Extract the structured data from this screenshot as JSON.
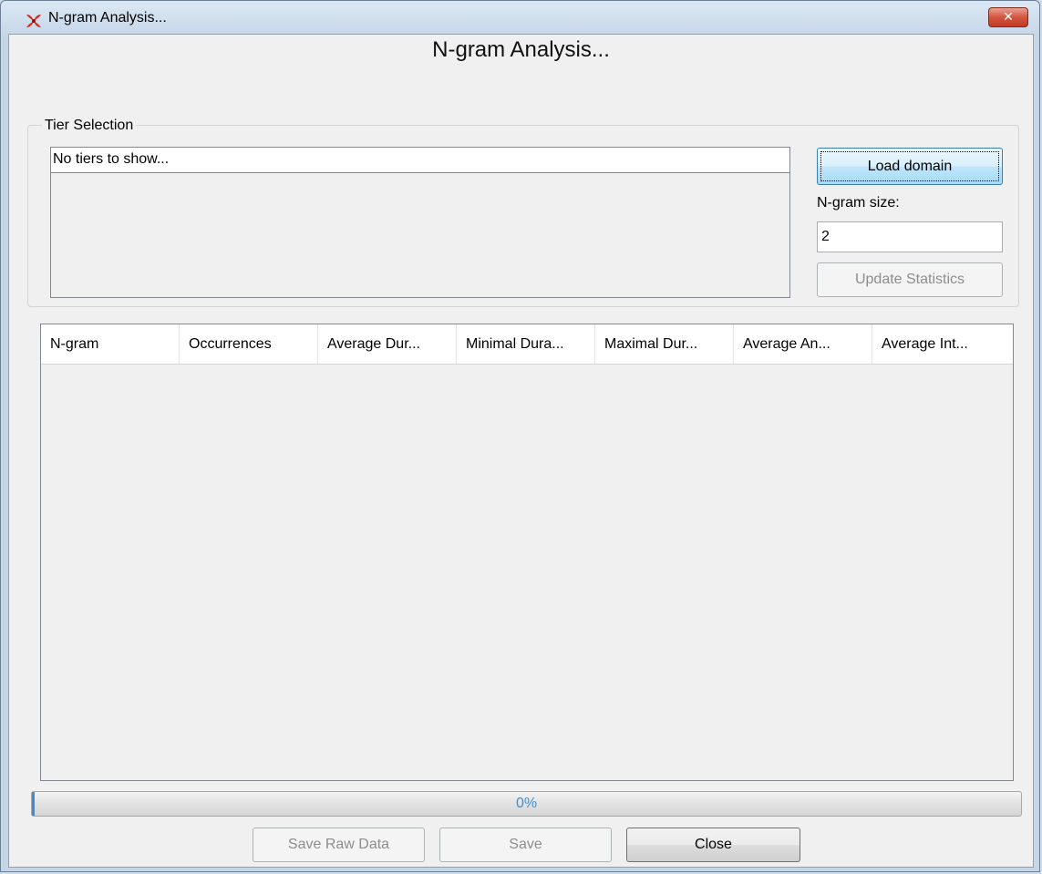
{
  "window": {
    "title": "N-gram Analysis...",
    "close_label": "✕"
  },
  "heading": "N-gram Analysis...",
  "tier_selection": {
    "group_label": "Tier Selection",
    "empty_text": "No tiers to show..."
  },
  "controls": {
    "load_domain_label": "Load domain",
    "ngram_size_label": "N-gram size:",
    "ngram_size_value": "2",
    "update_statistics_label": "Update Statistics"
  },
  "table": {
    "columns": [
      "N-gram",
      "Occurrences",
      "Average Dur...",
      "Minimal Dura...",
      "Maximal Dur...",
      "Average An...",
      "Average Int..."
    ]
  },
  "progress": {
    "value": 0,
    "text": "0%"
  },
  "buttons": {
    "save_raw_data": "Save Raw Data",
    "save": "Save",
    "close": "Close"
  },
  "colors": {
    "accent": "#3b8fd9",
    "close_button": "#c23a24",
    "app_icon": "#d42e1c"
  }
}
